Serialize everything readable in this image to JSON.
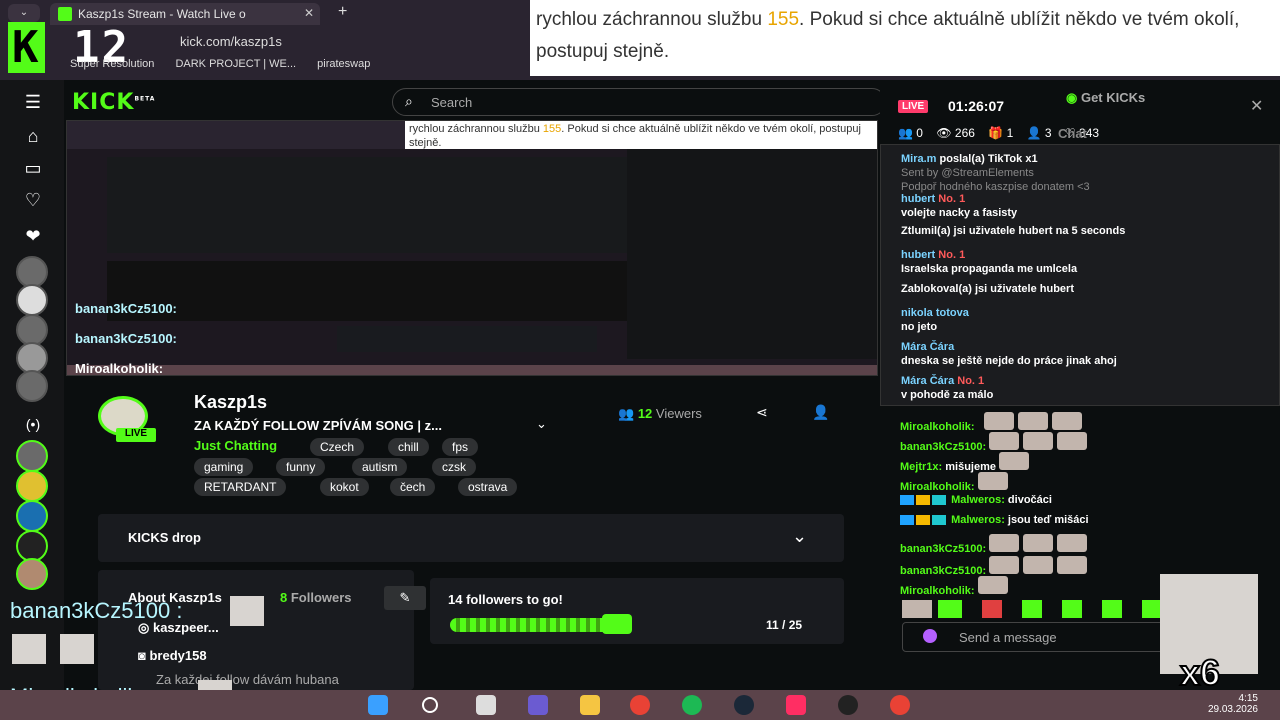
{
  "browser": {
    "tab_title": "Kaszp1s Stream - Watch Live o",
    "new_tab": "+",
    "url": "kick.com/kaszp1s",
    "bookmarks": [
      "Super Resolution",
      "DARK PROJECT | WE...",
      "pirateswap"
    ],
    "overlay_logo": "12"
  },
  "notice": {
    "pre": "rychlou záchrannou službu ",
    "num": "155",
    "post": ". Pokud si chce aktuálně ublížit někdo ve tvém okolí, postupuj stejně."
  },
  "kick": {
    "logo": "KICK",
    "logo_beta": "BETA",
    "search_placeholder": "Search",
    "channel": {
      "name": "Kaszp1s",
      "title": "ZA KAŽDÝ FOLLOW ZPÍVÁM SONG | z...",
      "category": "Just Chatting",
      "tags": [
        "Czech",
        "chill",
        "fps",
        "gaming",
        "funny",
        "autism",
        "czsk",
        "RETARDANT",
        "kokot",
        "čech",
        "ostrava"
      ],
      "viewers": "12",
      "viewers_label": "Viewers",
      "live": "LIVE"
    },
    "kicks_drop": "KICKS drop",
    "about": {
      "title": "About Kaszp1s",
      "followers": "8",
      "followers_label": "Followers",
      "instagram": "kaszpeer...",
      "discord": "bredy158",
      "bio": "Za každej follow dávám hubana"
    },
    "goal": {
      "title": "14 followers to go!",
      "progress": "11 / 25",
      "fraction": 0.44
    }
  },
  "chat": {
    "live": "LIVE",
    "uptime": "01:26:07",
    "get_kicks": "Get KICKs",
    "header": "Chat",
    "stats": {
      "a": "0",
      "b": "266",
      "c": "1",
      "d": "3",
      "e": "343"
    },
    "popup_lines": [
      {
        "user": "Mira.m",
        "text": "poslal(a) TikTok",
        "extra": "x1"
      },
      {
        "user": "",
        "text": "Sent by @StreamElements",
        "extra": ""
      },
      {
        "user": "",
        "text": "Podpoř hodného kaszpise donatem <3",
        "extra": ""
      },
      {
        "user": "hubert",
        "text": "No. 1",
        "extra": ""
      },
      {
        "user": "",
        "text": "volejte nacky a fasisty",
        "extra": ""
      },
      {
        "user": "",
        "text": "Ztlumil(a) jsi uživatele hubert na 5 seconds",
        "extra": ""
      },
      {
        "user": "hubert",
        "text": "No. 1",
        "extra": ""
      },
      {
        "user": "",
        "text": "Israelska propaganda me umlcela",
        "extra": ""
      },
      {
        "user": "",
        "text": "Zablokoval(a) jsi uživatele hubert",
        "extra": ""
      },
      {
        "user": "nikola totova",
        "text": "",
        "extra": ""
      },
      {
        "user": "",
        "text": "no jeto",
        "extra": ""
      },
      {
        "user": "Mára Čára",
        "text": "",
        "extra": ""
      },
      {
        "user": "",
        "text": "dneska se ještě nejde do práce jinak ahoj",
        "extra": ""
      },
      {
        "user": "Mára Čára",
        "text": "No. 1",
        "extra": ""
      },
      {
        "user": "",
        "text": "v pohodě za málo",
        "extra": ""
      }
    ],
    "messages": [
      {
        "user": "Miroalkoholik:",
        "text": ""
      },
      {
        "user": "banan3kCz5100:",
        "text": ""
      },
      {
        "user": "Mejtr1x:",
        "text": "mišujeme"
      },
      {
        "user": "Miroalkoholik:",
        "text": ""
      },
      {
        "user": "Malweros:",
        "text": "divočáci"
      },
      {
        "user": "Malweros:",
        "text": "jsou teď mišáci"
      },
      {
        "user": "banan3kCz5100:",
        "text": ""
      },
      {
        "user": "banan3kCz5100:",
        "text": ""
      },
      {
        "user": "Miroalkoholik:",
        "text": ""
      }
    ],
    "send_placeholder": "Send a message"
  },
  "overlay": {
    "user1": "banan3kCz5100 :",
    "user2": "Miroalkoholik :",
    "combo": "x6"
  },
  "taskbar": {
    "time": "4:15",
    "date": "29.03.2026"
  },
  "colors": {
    "accent": "#53fc18",
    "notice_number": "#e8a400",
    "live": "#ff3b6b"
  }
}
